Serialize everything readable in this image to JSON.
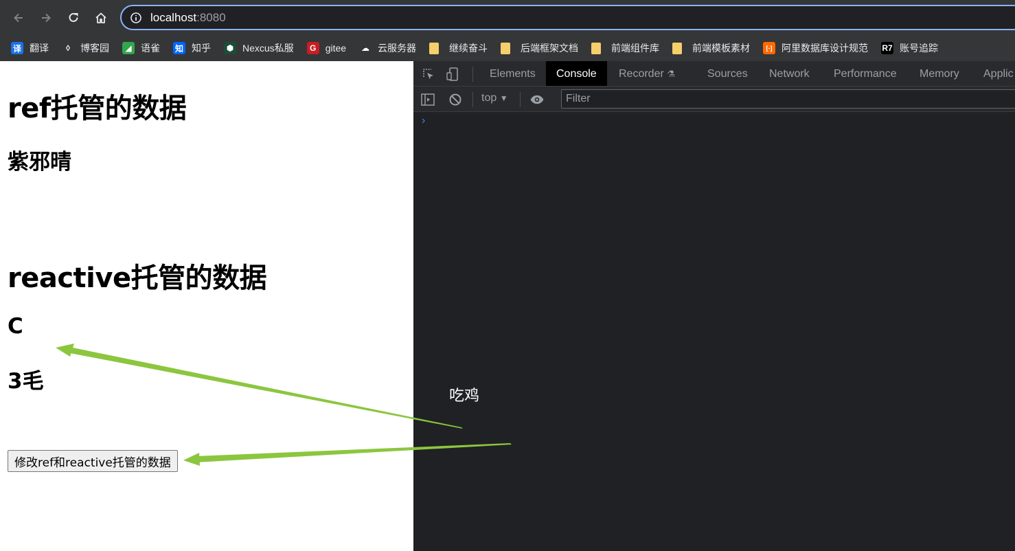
{
  "browser": {
    "url_host": "localhost",
    "url_port": ":8080"
  },
  "bookmarks": [
    {
      "label": "翻译",
      "icon": "translate-icon",
      "color": "#1a73e8",
      "glyph": "译"
    },
    {
      "label": "博客园",
      "icon": "cnblogs-icon",
      "color": "#353638",
      "glyph": "◊"
    },
    {
      "label": "语雀",
      "icon": "yuque-icon",
      "color": "#31a64d",
      "glyph": "◢"
    },
    {
      "label": "知乎",
      "icon": "zhihu-icon",
      "color": "#0066ff",
      "glyph": "知"
    },
    {
      "label": "Nexcus私服",
      "icon": "nexus-icon",
      "color": "#1d4c38",
      "glyph": "⬢"
    },
    {
      "label": "gitee",
      "icon": "gitee-icon",
      "color": "#c71d23",
      "glyph": "G"
    },
    {
      "label": "云服务器",
      "icon": "cloud-icon",
      "color": "#353638",
      "glyph": "☁"
    },
    {
      "label": "继续奋斗",
      "icon": "folder-icon"
    },
    {
      "label": "后端框架文档",
      "icon": "folder-icon"
    },
    {
      "label": "前端组件库",
      "icon": "folder-icon"
    },
    {
      "label": "前端模板素材",
      "icon": "folder-icon"
    },
    {
      "label": "阿里数据库设计规范",
      "icon": "aliyun-icon",
      "color": "#ff6a00",
      "glyph": "[-]"
    },
    {
      "label": "账号追踪",
      "icon": "r7-icon",
      "color": "#000000",
      "glyph": "R7"
    }
  ],
  "page": {
    "ref_heading": "ref托管的数据",
    "ref_value": "紫邪晴",
    "reactive_heading": "reactive托管的数据",
    "reactive_value_1": "C",
    "reactive_value_2": "3毛",
    "button_label": "修改ref和reactive托管的数据"
  },
  "devtools": {
    "tabs": [
      "Elements",
      "Console",
      "Recorder",
      "Sources",
      "Network",
      "Performance",
      "Memory",
      "Applic"
    ],
    "active_tab": "Console",
    "context": "top",
    "filter_placeholder": "Filter",
    "prompt": "›"
  },
  "annotation": {
    "text": "吃鸡",
    "arrow_color": "#8cc63f"
  }
}
